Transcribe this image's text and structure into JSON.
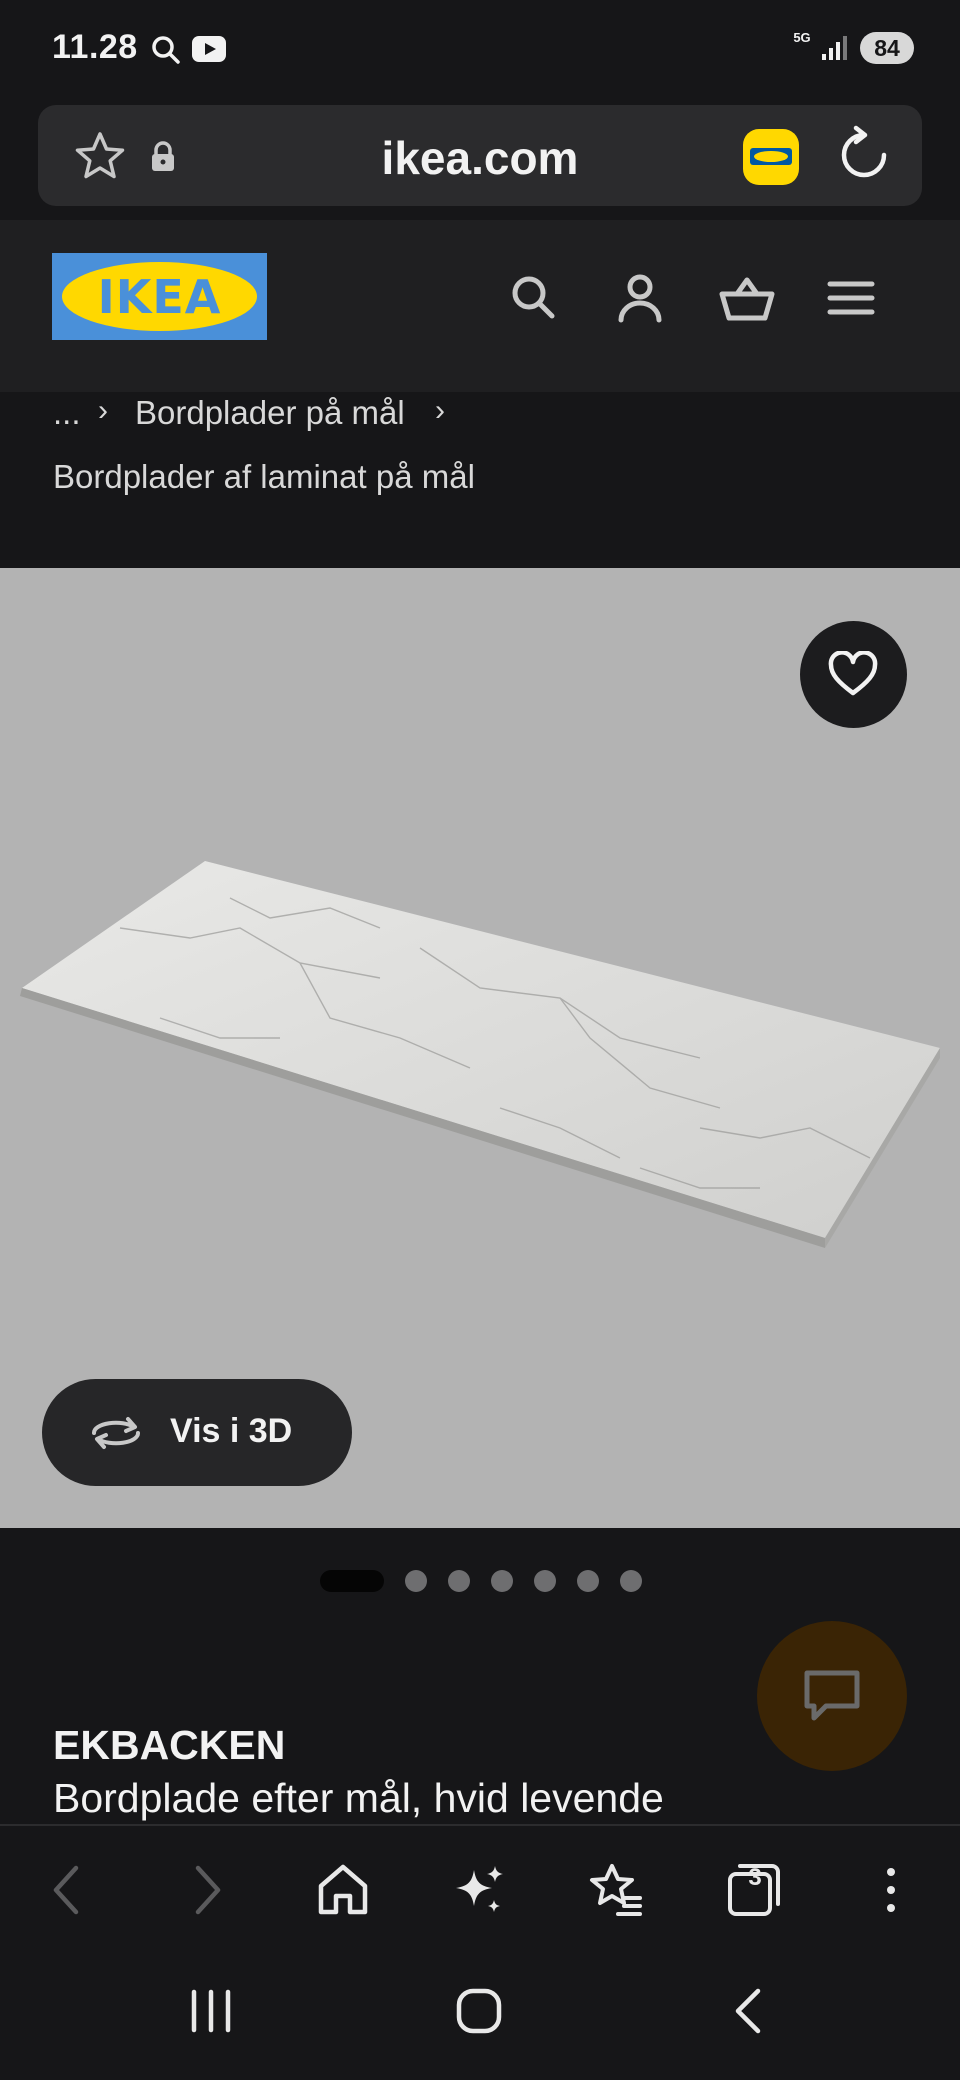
{
  "status_bar": {
    "time": "11.28",
    "network": "5G",
    "battery": "84"
  },
  "browser": {
    "url": "ikea.com",
    "tab_count": "3"
  },
  "breadcrumb": {
    "ellipsis": "...",
    "parent": "Bordplader på mål",
    "current": "Bordplader af laminat på mål"
  },
  "header": {
    "logo_text": "IKEA",
    "icons": [
      "search-icon",
      "user-icon",
      "basket-icon",
      "menu-icon"
    ]
  },
  "gallery": {
    "view_3d_label": "Vis i 3D",
    "image_count": 7,
    "active_index": 0
  },
  "product": {
    "name": "EKBACKEN",
    "description": "Bordplade efter mål, hvid levende"
  },
  "colors": {
    "ikea_blue": "#4a90d9",
    "ikea_yellow": "#ffd800",
    "image_bg": "#b3b3b3",
    "chat_fab": "#3a2405"
  }
}
